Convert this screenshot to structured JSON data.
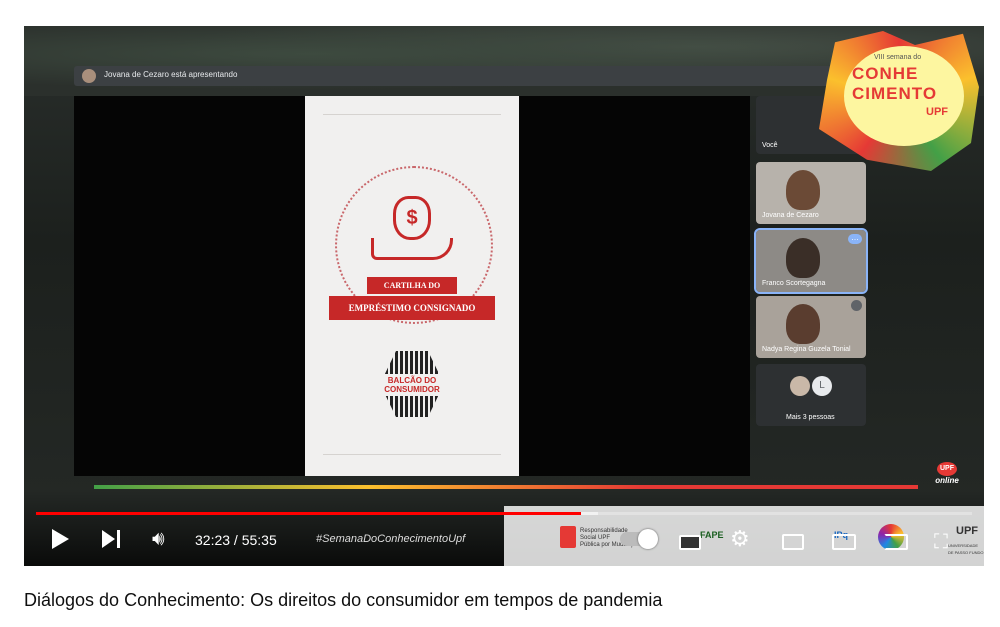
{
  "meet": {
    "presenter_banner": "Jovana de Cezaro está apresentando",
    "you_label": "Você",
    "participants": [
      {
        "name": "Jovana de Cezaro"
      },
      {
        "name": "Franco Scortegagna"
      },
      {
        "name": "Nadya Regina Guzela Tonial"
      }
    ],
    "more_people_initial": "L",
    "more_people": "Mais 3 pessoas"
  },
  "slide": {
    "line1": "CARTILHA DO",
    "line2": "EMPRÉSTIMO CONSIGNADO",
    "logo_line1": "BALCÃO DO",
    "logo_line2": "CONSUMIDOR",
    "currency_symbol": "$"
  },
  "event_logo": {
    "small": "VIII semana do",
    "big1": "CONHE",
    "big2": "CIMENTO",
    "org": "UPF"
  },
  "online_badge": {
    "brand": "UPF",
    "label": "online"
  },
  "player": {
    "current_time": "32:23",
    "separator": " / ",
    "duration": "55:35",
    "progress": 0.5825,
    "buffered": 0.6,
    "hashtag": "#SemanaDoConhecimentoUpf"
  },
  "sponsors": {
    "rs_line1": "Responsabilidade",
    "rs_line2": "Social UPF",
    "rs_line3": "Pública por Mudanças",
    "fapergs": "FAPE",
    "ipq": "IPq",
    "ufcp": "UPF",
    "univ": "UNIVERSIDADE DE PASSO FUNDO"
  },
  "video": {
    "title": "Diálogos do Conhecimento: Os direitos do consumidor em tempos de pandemia"
  },
  "colors": {
    "accent_red": "#c62828",
    "progress_red": "#ff0000"
  }
}
